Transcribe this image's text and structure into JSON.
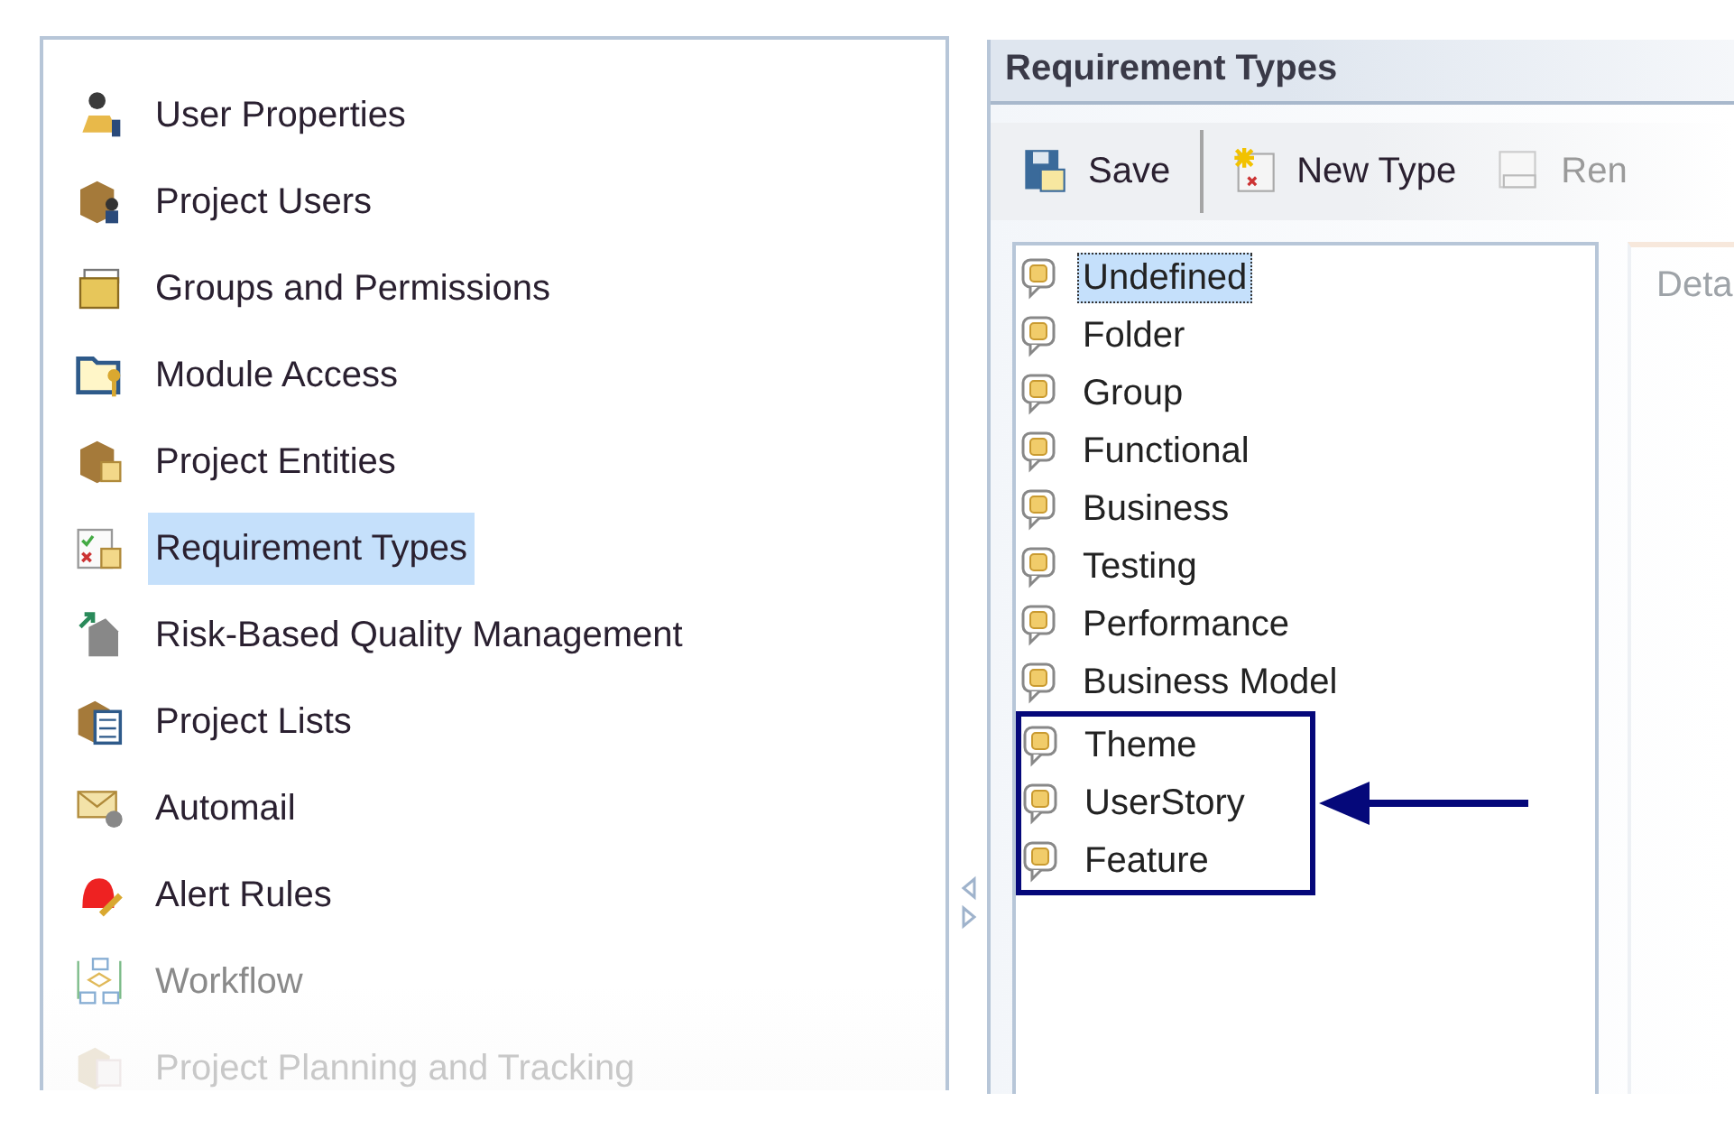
{
  "sidebar": {
    "items": [
      {
        "label": "User Properties",
        "selected": false,
        "disabled": false
      },
      {
        "label": "Project Users",
        "selected": false,
        "disabled": false
      },
      {
        "label": "Groups and Permissions",
        "selected": false,
        "disabled": false
      },
      {
        "label": "Module Access",
        "selected": false,
        "disabled": false
      },
      {
        "label": "Project Entities",
        "selected": false,
        "disabled": false
      },
      {
        "label": "Requirement Types",
        "selected": true,
        "disabled": false
      },
      {
        "label": "Risk-Based Quality Management",
        "selected": false,
        "disabled": false
      },
      {
        "label": "Project Lists",
        "selected": false,
        "disabled": false
      },
      {
        "label": "Automail",
        "selected": false,
        "disabled": false
      },
      {
        "label": "Alert Rules",
        "selected": false,
        "disabled": false
      },
      {
        "label": "Workflow",
        "selected": false,
        "disabled": true
      },
      {
        "label": "Project Planning and Tracking",
        "selected": false,
        "disabled": true
      }
    ]
  },
  "panel": {
    "title": "Requirement Types",
    "toolbar": [
      {
        "label": "Save",
        "disabled": false
      },
      {
        "label": "New Type",
        "disabled": false
      },
      {
        "label": "Ren",
        "disabled": true
      }
    ],
    "types": [
      {
        "label": "Undefined",
        "selected": true,
        "highlighted": false
      },
      {
        "label": "Folder",
        "selected": false,
        "highlighted": false
      },
      {
        "label": "Group",
        "selected": false,
        "highlighted": false
      },
      {
        "label": "Functional",
        "selected": false,
        "highlighted": false
      },
      {
        "label": "Business",
        "selected": false,
        "highlighted": false
      },
      {
        "label": "Testing",
        "selected": false,
        "highlighted": false
      },
      {
        "label": "Performance",
        "selected": false,
        "highlighted": false
      },
      {
        "label": "Business Model",
        "selected": false,
        "highlighted": false
      },
      {
        "label": "Theme",
        "selected": false,
        "highlighted": true
      },
      {
        "label": "UserStory",
        "selected": false,
        "highlighted": true
      },
      {
        "label": "Feature",
        "selected": false,
        "highlighted": true
      }
    ],
    "details_label": "Deta"
  }
}
